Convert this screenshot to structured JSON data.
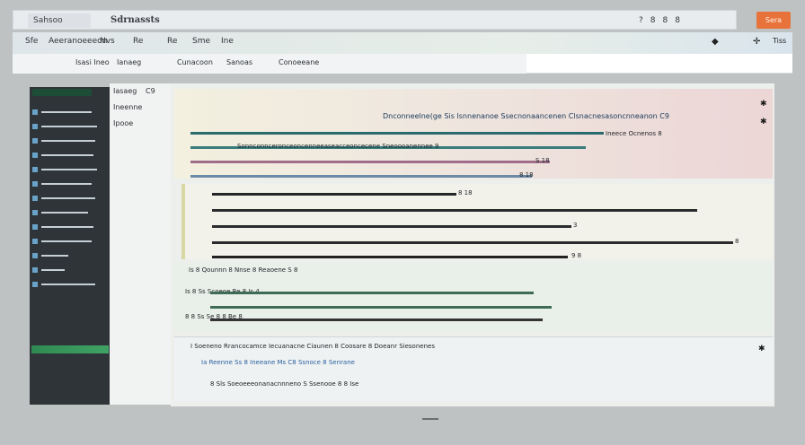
{
  "window": {
    "tabs": [
      "Sahsoo",
      "Sdrnassts"
    ],
    "controls": [
      "?",
      "8",
      "8",
      "8"
    ],
    "action_button": "Sera"
  },
  "menubar": {
    "items": [
      "Sfe",
      "Aeeranoeeeon",
      "Nvs",
      "Re",
      "Re",
      "Sme",
      "Ine"
    ],
    "right_icons": [
      "◆",
      "✛",
      "Tiss"
    ]
  },
  "addressbar": {
    "items": [
      "Isasi Ineo",
      "Ianaeg",
      "Cunacoon",
      "Sanoas",
      "Conoeeane"
    ]
  },
  "navpanel": {
    "items": [
      "Iasaeg",
      "C9",
      "Ineenne",
      "Ipooe"
    ]
  },
  "content": {
    "band1": {
      "header": "Dnconneelne(ge Sis Isnnenanoe Ssecnonaancenen Clsnacnesasoncnneanon C9",
      "lines": [
        "Sonnconnceronceoncenneeaseacceoncecene Sneoooanennee 9",
        "Ineece Ocnenos 8",
        "S 18",
        "8 18"
      ]
    },
    "band2": {
      "rows": [
        "8 18",
        "3",
        "8",
        "9 8"
      ]
    },
    "band3": {
      "rows": [
        "Is 8 Qounnn 8 Nnse 8 Reaoene S 8",
        "Is 8 Ss Scoeoe Re 8 Is 4",
        "8 8 Ss Se 8 8 Be 8"
      ]
    },
    "band4": {
      "rows": [
        "I Soeneno Rrancocamce Iecuanacne Ciaunen 8 Coosare 8 Doeanr Siesonenes",
        "Ia Reenne Ss 8 Ineeane Ms C8 Ssnoce 8 Senrane",
        "8 Sls Soeoeeeonanacnnneno S Ssenooe 8 8 Ise"
      ]
    }
  },
  "colors": {
    "accent_orange": "#e8733a",
    "sidebar_dark": "#2f3438",
    "highlight_green": "#2f8a52"
  }
}
